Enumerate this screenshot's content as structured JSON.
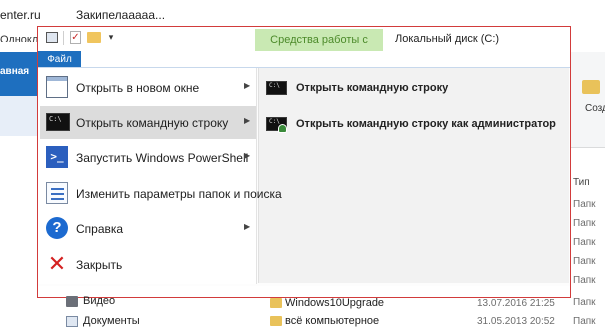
{
  "browser": {
    "tab_1": "enter.ru",
    "tab_2": "Закипелааааа...",
    "bookmark_1": "Однокла"
  },
  "explorer": {
    "left_pane_label": "авная",
    "disk_tools_tab": "Средства работы с дисками",
    "window_title": "Локальный диск (C:)",
    "file_tab": "Файл",
    "right_ribbon_create": "Созд",
    "column_type": "Тип",
    "type_cells": [
      "Папк",
      "Папк",
      "Папк",
      "Папк",
      "Папк",
      "Папк",
      "Папк",
      "Папк"
    ]
  },
  "file_menu": {
    "items": [
      {
        "label": "Открыть в новом окне",
        "icon": "new-window-icon",
        "has_submenu": true
      },
      {
        "label": "Открыть командную строку",
        "icon": "command-prompt-icon",
        "has_submenu": true,
        "selected": true
      },
      {
        "label": "Запустить Windows PowerShell",
        "icon": "powershell-icon",
        "has_submenu": true
      },
      {
        "label": "Изменить параметры папок и поиска",
        "icon": "folder-options-icon",
        "has_submenu": false
      },
      {
        "label": "Справка",
        "icon": "help-icon",
        "has_submenu": true
      },
      {
        "label": "Закрыть",
        "icon": "close-icon",
        "has_submenu": false
      }
    ],
    "submenu": [
      {
        "label": "Открыть командную строку",
        "icon": "command-prompt-icon"
      },
      {
        "label": "Открыть командную строку как администратор",
        "icon": "command-prompt-admin-icon"
      }
    ]
  },
  "nav_items": [
    {
      "label": "Видео"
    },
    {
      "label": "Документы"
    }
  ],
  "files": [
    {
      "name": "Windows10Upgrade",
      "date": "13.07.2016 21:25"
    },
    {
      "name": "всё компьютерное",
      "date": "31.05.2013 20:52"
    }
  ]
}
